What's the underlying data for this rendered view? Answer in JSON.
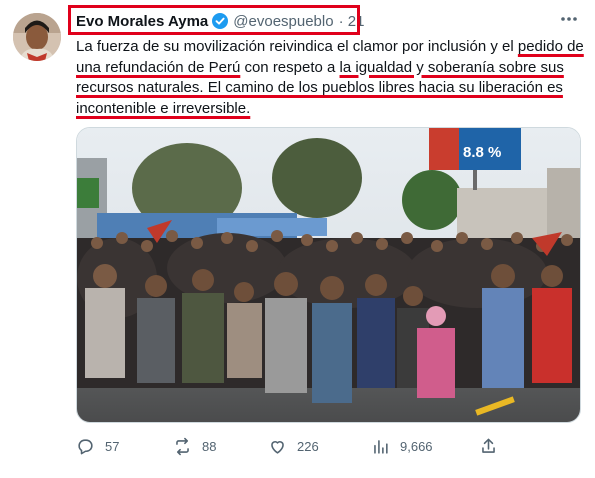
{
  "author": {
    "name": "Evo Morales Ayma",
    "handle": "@evoespueblo",
    "time": "· 21"
  },
  "tweet": {
    "segments": [
      {
        "text": "La fuerza de su movilización reivindica el clamor por inclusión y el ",
        "underline": false
      },
      {
        "text": "pedido de una refundación de Perú",
        "underline": true
      },
      {
        "text": " con respeto a ",
        "underline": false
      },
      {
        "text": "la igualdad y soberanía sobre sus recursos naturales. El camino de los pueblos libres hacia su liberación es incontenible e irreversible.",
        "underline": true
      }
    ]
  },
  "photo": {
    "billboard_text": "8.8 %"
  },
  "actions": {
    "replies": "57",
    "retweets": "88",
    "likes": "226",
    "views": "9,666"
  },
  "colors": {
    "annotation_red": "#e0001b",
    "verified_blue": "#1d9bf0",
    "muted_text": "#536471"
  }
}
